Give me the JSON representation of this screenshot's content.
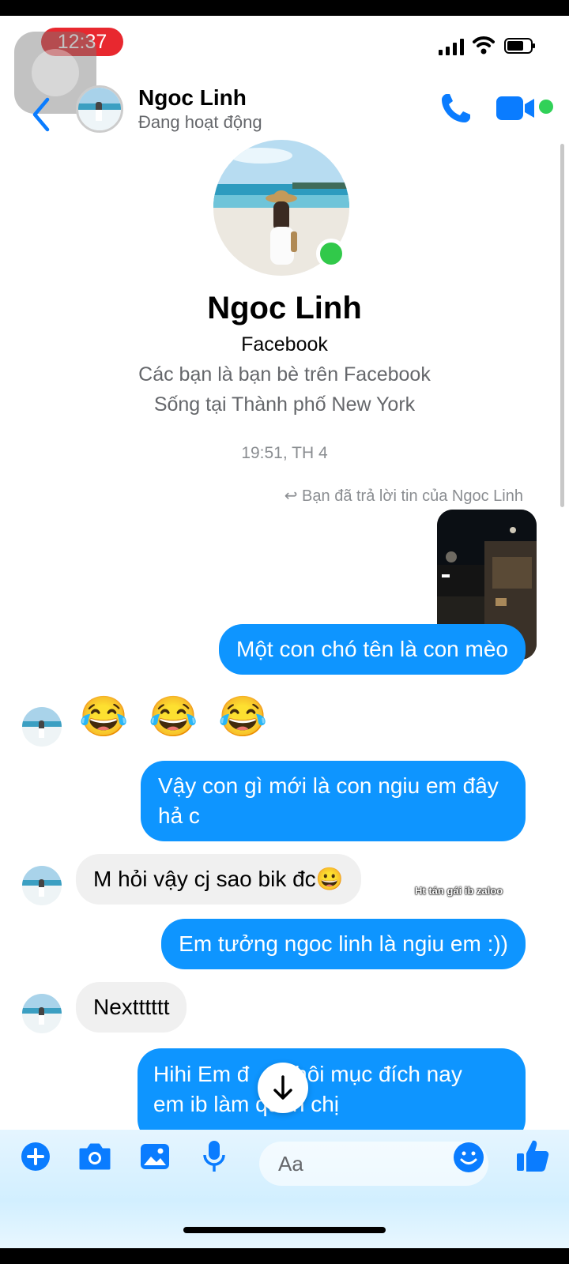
{
  "status_bar": {
    "time": "12:37"
  },
  "header": {
    "contact_name": "Ngoc Linh",
    "status": "Đang hoạt động"
  },
  "profile": {
    "name": "Ngoc Linh",
    "platform": "Facebook",
    "friends_note": "Các bạn là bạn bè trên Facebook",
    "location": "Sống tại Thành phố New York"
  },
  "thread": {
    "timestamp": "19:51, TH 4",
    "reply_note": "Bạn đã trả lời tin của Ngoc Linh",
    "messages": [
      {
        "from": "me",
        "text": "Một con chó tên là con mèo"
      },
      {
        "from": "them",
        "text": "😂 😂 😂"
      },
      {
        "from": "me",
        "text": "Vậy con gì mới là con ngiu em đây hả c"
      },
      {
        "from": "them",
        "text": "M hỏi vậy cj sao bik đc😀"
      },
      {
        "from": "me",
        "text": "Em tưởng ngoc linh là ngiu em :))"
      },
      {
        "from": "them",
        "text": "Nextttttt"
      },
      {
        "from": "me",
        "text": "Hihi Em đ",
        "text_end": "i thôi mục đích nay",
        "text_line2": "em ib làm quen chị"
      }
    ]
  },
  "overlay_caption": "Ht tán gái ib zaloo",
  "composer": {
    "placeholder": "Aa"
  },
  "colors": {
    "accent": "#0084ff",
    "outgoing_bubble": "#0e95ff",
    "incoming_bubble": "#f0f0f0",
    "online": "#31d158"
  },
  "icons": [
    "back-icon",
    "phone-icon",
    "video-icon",
    "plus-icon",
    "camera-icon",
    "gallery-icon",
    "mic-icon",
    "emoji-icon",
    "like-icon",
    "arrow-down-icon"
  ]
}
